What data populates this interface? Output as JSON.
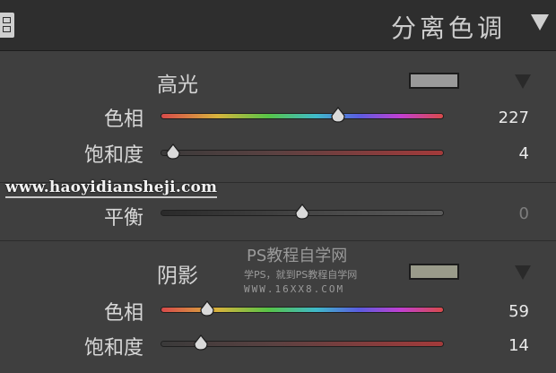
{
  "panel": {
    "title": "分离色调",
    "toggle_icon": "triangle-down-icon"
  },
  "highlights": {
    "label": "高光",
    "swatch_color": "#9a9a9a",
    "hue": {
      "label": "色相",
      "value": "227",
      "position": 0.627
    },
    "saturation": {
      "label": "饱和度",
      "value": "4",
      "position": 0.04
    }
  },
  "balance": {
    "label": "平衡",
    "value": "0",
    "position": 0.5
  },
  "shadows": {
    "label": "阴影",
    "swatch_color": "#9a9b8a",
    "hue": {
      "label": "色相",
      "value": "59",
      "position": 0.164
    },
    "saturation": {
      "label": "饱和度",
      "value": "14",
      "position": 0.14
    }
  },
  "watermarks": {
    "url": "www.haoyidiansheji.com",
    "title": "PS教程自学网",
    "subtitle": "学PS，就到PS教程自学网",
    "site": "WWW.16XX8.COM"
  }
}
